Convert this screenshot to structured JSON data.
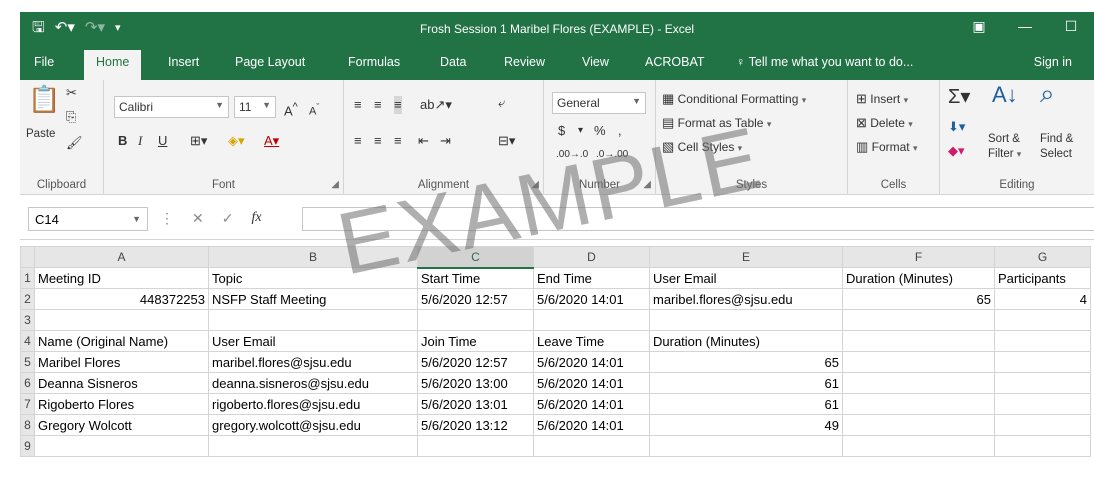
{
  "app": {
    "window_title": "Frosh Session 1 Maribel Flores (EXAMPLE) - Excel",
    "watermark": "EXAMPLE"
  },
  "tabs": [
    "File",
    "Home",
    "Insert",
    "Page Layout",
    "Formulas",
    "Data",
    "Review",
    "View",
    "ACROBAT"
  ],
  "active_tab": "Home",
  "tell_me": "Tell me what you want to do...",
  "sign_in": "Sign in",
  "ribbon": {
    "clipboard": {
      "paste": "Paste",
      "label": "Clipboard"
    },
    "font": {
      "name": "Calibri",
      "size": "11",
      "label": "Font",
      "bold": "B",
      "italic": "I",
      "underline": "U"
    },
    "alignment": {
      "label": "Alignment"
    },
    "number": {
      "format": "General",
      "label": "Number",
      "currency": "$",
      "percent": "%"
    },
    "styles": {
      "conditional": "Conditional Formatting",
      "format_table": "Format as Table",
      "cell_styles": "Cell Styles",
      "label": "Styles"
    },
    "cells": {
      "insert": "Insert",
      "delete": "Delete",
      "format": "Format",
      "label": "Cells"
    },
    "editing": {
      "sort": "Sort &",
      "filter": "Filter",
      "find": "Find &",
      "select": "Select",
      "label": "Editing"
    }
  },
  "formula_bar": {
    "name_box": "C14",
    "value": ""
  },
  "colors": {
    "excel_green": "#217346",
    "ribbon_bg": "#f3f3f3"
  },
  "columns": [
    "A",
    "B",
    "C",
    "D",
    "E",
    "F",
    "G"
  ],
  "selected_column": "C",
  "rows": [
    {
      "n": "1",
      "cells": [
        "Meeting ID",
        "Topic",
        "Start Time",
        "End Time",
        "User Email",
        "Duration (Minutes)",
        "Participants"
      ]
    },
    {
      "n": "2",
      "cells": [
        "448372253",
        "NSFP Staff Meeting",
        "5/6/2020 12:57",
        "5/6/2020 14:01",
        "maribel.flores@sjsu.edu",
        "65",
        "4"
      ]
    },
    {
      "n": "3",
      "cells": [
        "",
        "",
        "",
        "",
        "",
        "",
        ""
      ]
    },
    {
      "n": "4",
      "cells": [
        "Name (Original Name)",
        "User Email",
        "Join Time",
        "Leave Time",
        "Duration (Minutes)",
        "",
        ""
      ]
    },
    {
      "n": "5",
      "cells": [
        "Maribel Flores",
        "maribel.flores@sjsu.edu",
        "5/6/2020 12:57",
        "5/6/2020 14:01",
        "65",
        "",
        ""
      ]
    },
    {
      "n": "6",
      "cells": [
        "Deanna Sisneros",
        "deanna.sisneros@sjsu.edu",
        "5/6/2020 13:00",
        "5/6/2020 14:01",
        "61",
        "",
        ""
      ]
    },
    {
      "n": "7",
      "cells": [
        "Rigoberto Flores",
        "rigoberto.flores@sjsu.edu",
        "5/6/2020 13:01",
        "5/6/2020 14:01",
        "61",
        "",
        ""
      ]
    },
    {
      "n": "8",
      "cells": [
        "Gregory Wolcott",
        "gregory.wolcott@sjsu.edu",
        "5/6/2020 13:12",
        "5/6/2020 14:01",
        "49",
        "",
        ""
      ]
    },
    {
      "n": "9",
      "cells": [
        "",
        "",
        "",
        "",
        "",
        "",
        ""
      ]
    }
  ]
}
